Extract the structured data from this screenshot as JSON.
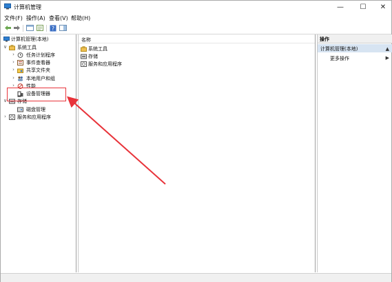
{
  "window": {
    "title": "计算机管理",
    "controls": {
      "minimize": "—",
      "maximize": "☐",
      "close": "✕"
    }
  },
  "menu": [
    "文件(F)",
    "操作(A)",
    "查看(V)",
    "帮助(H)"
  ],
  "toolbar": {
    "icons": [
      "back-icon",
      "forward-icon",
      "console-tree-icon",
      "properties-icon",
      "help-icon",
      "view-icon"
    ]
  },
  "tree": {
    "root": "计算机管理(本地)",
    "system_tools": "系统工具",
    "task_scheduler": "任务计划程序",
    "event_viewer": "事件查看器",
    "shared_folders": "共享文件夹",
    "local_users": "本地用户和组",
    "performance": "性能",
    "device_manager": "设备管理器",
    "storage": "存储",
    "disk_management": "磁盘管理",
    "services_apps": "服务和应用程序"
  },
  "list": {
    "header": "名称",
    "items": [
      "系统工具",
      "存储",
      "服务和应用程序"
    ]
  },
  "actions": {
    "header": "操作",
    "selected": "计算机管理(本地)",
    "more": "更多操作"
  },
  "colors": {
    "annotation_red": "#e8333a",
    "selection_blue": "#d7e4f2"
  }
}
